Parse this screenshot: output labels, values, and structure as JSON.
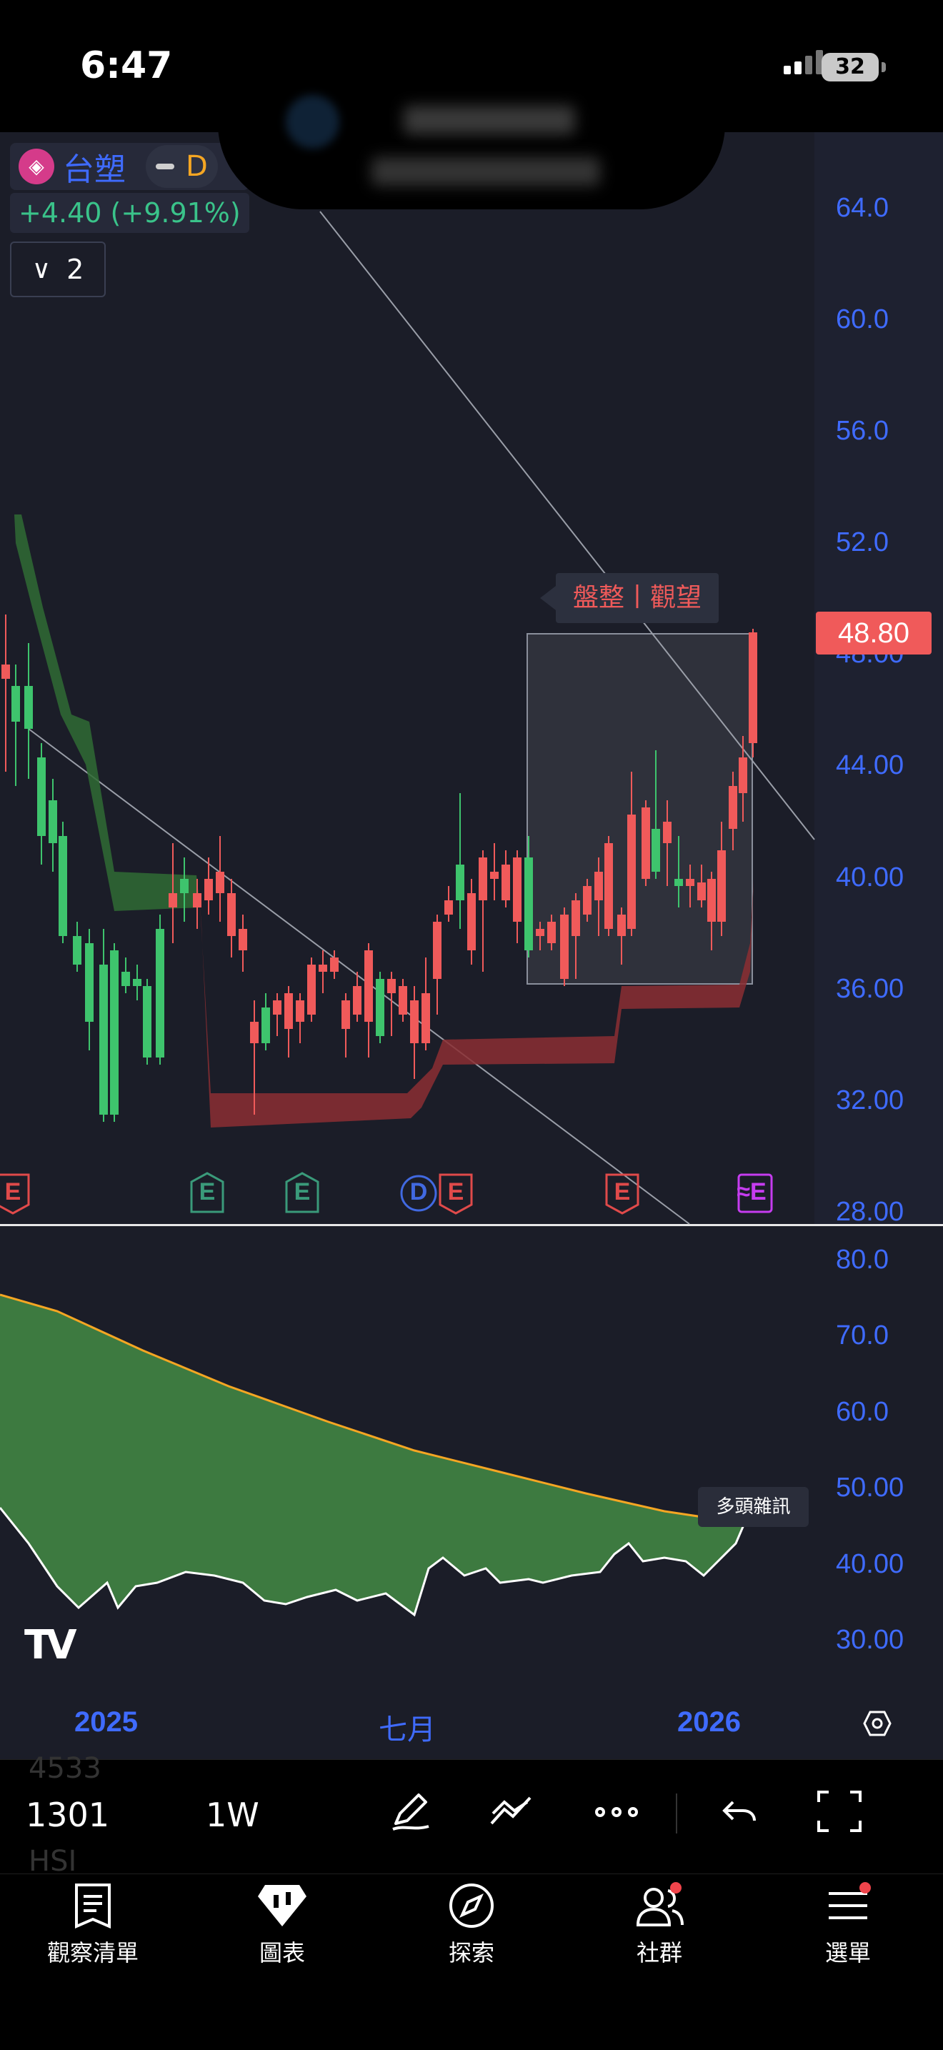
{
  "status_bar": {
    "time": "6:47",
    "battery": "32"
  },
  "symbol": {
    "name": "台塑",
    "interval_badge": "D",
    "change": "+4.40 (+9.91%)",
    "indicator_count": "2"
  },
  "pattern_label": "盤整丨觀望",
  "price_axis": {
    "ticks": [
      "64.0",
      "60.0",
      "56.0",
      "52.0",
      "48.00",
      "44.00",
      "40.00",
      "36.00",
      "32.00",
      "28.00"
    ],
    "last_price": "48.80"
  },
  "lower_axis": {
    "ticks": [
      "80.0",
      "70.0",
      "60.0",
      "50.00",
      "40.00",
      "30.00"
    ]
  },
  "noise_label": "多頭雜訊",
  "event_markers": [
    {
      "label": "E",
      "kind": "earnings-negative"
    },
    {
      "label": "E",
      "kind": "earnings-positive"
    },
    {
      "label": "E",
      "kind": "earnings-positive"
    },
    {
      "label": "D",
      "kind": "dividend"
    },
    {
      "label": "E",
      "kind": "earnings-negative"
    },
    {
      "label": "E",
      "kind": "earnings-negative"
    },
    {
      "label": "≈E",
      "kind": "upcoming-earnings"
    }
  ],
  "time_axis": [
    "2025",
    "七月",
    "2026"
  ],
  "toolbar": {
    "symbol": "1301",
    "interval": "1W",
    "ghost_top": "4533",
    "ghost_bottom": "HSI"
  },
  "tabs": [
    {
      "label": "觀察清單",
      "icon": "watchlist-icon"
    },
    {
      "label": "圖表",
      "icon": "chart-icon"
    },
    {
      "label": "探索",
      "icon": "compass-icon"
    },
    {
      "label": "社群",
      "icon": "community-icon"
    },
    {
      "label": "選單",
      "icon": "menu-icon"
    }
  ],
  "colors": {
    "up": "#f05a5a",
    "down": "#3ec46d",
    "accent": "#3f6bff",
    "band_lower": "#8b2e33",
    "band_upper": "#2f6b34"
  }
}
